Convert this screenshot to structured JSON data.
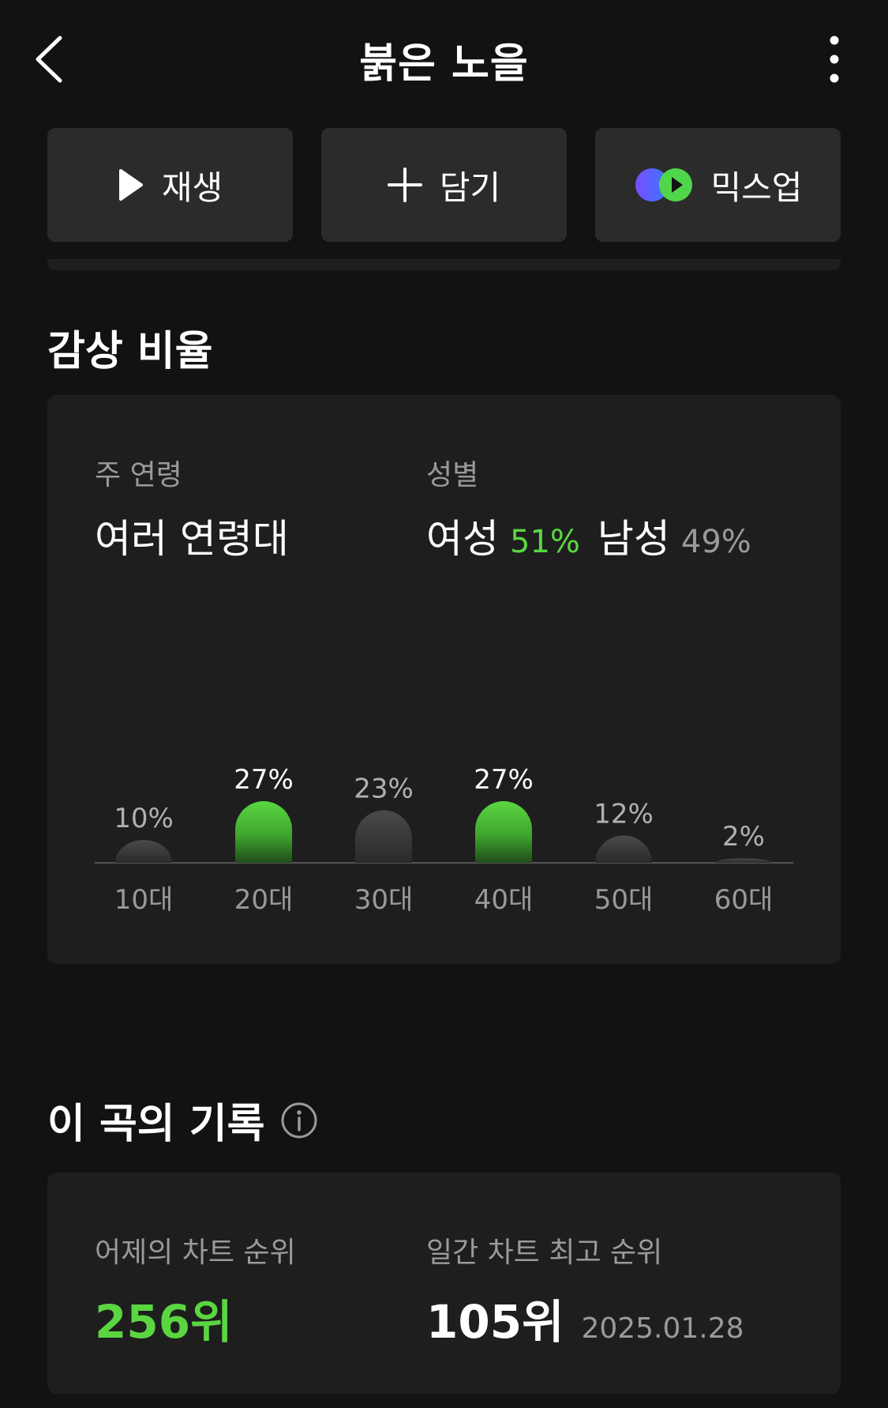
{
  "header": {
    "title": "붉은 노을"
  },
  "actions": {
    "play_label": "재생",
    "add_label": "담기",
    "mixup_label": "믹스업"
  },
  "ratio": {
    "title": "감상 비율",
    "age_label": "주 연령",
    "age_value": "여러 연령대",
    "gender_label": "성별",
    "female_label": "여성",
    "female_pct": "51%",
    "male_label": "남성",
    "male_pct": "49%"
  },
  "chart_data": {
    "type": "bar",
    "title": "",
    "xlabel": "",
    "ylabel": "",
    "ylim": [
      0,
      30
    ],
    "categories": [
      "10대",
      "20대",
      "30대",
      "40대",
      "50대",
      "60대"
    ],
    "values": [
      10,
      27,
      23,
      27,
      12,
      2
    ],
    "data_labels": [
      "10%",
      "27%",
      "23%",
      "27%",
      "12%",
      "2%"
    ],
    "highlighted": [
      false,
      true,
      false,
      true,
      false,
      false
    ],
    "colors": {
      "highlight": "#5ad641",
      "normal": "#4a4a4a",
      "axis": "#555555",
      "label_highlight": "#ffffff",
      "label_normal": "#b0b0b0",
      "category": "#9a9a9a"
    }
  },
  "record": {
    "title": "이 곡의 기록",
    "yesterday_label": "어제의 차트 순위",
    "yesterday_rank": "256위",
    "best_label": "일간 차트 최고 순위",
    "best_rank": "105위",
    "best_date": "2025.01.28"
  },
  "icons": {
    "back": "chevron-left-icon",
    "more": "more-vertical-icon",
    "play": "play-icon",
    "add": "plus-icon",
    "mixup": "mixup-icon",
    "info": "info-icon"
  },
  "colors": {
    "background": "#121212",
    "card": "#1e1e1e",
    "button": "#2b2b2b",
    "accent": "#5ad641",
    "muted": "#9a9a9a"
  }
}
